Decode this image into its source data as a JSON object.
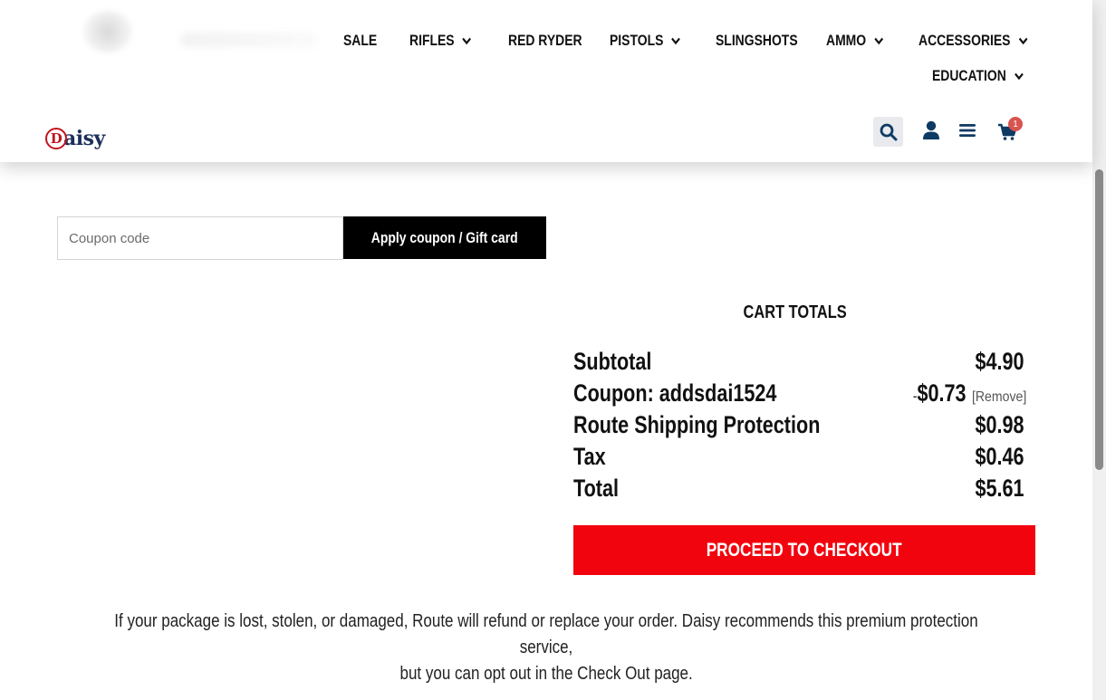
{
  "nav": {
    "items": [
      {
        "label": "SALE",
        "has_dropdown": false
      },
      {
        "label": "RIFLES",
        "has_dropdown": true
      },
      {
        "label": "RED RYDER",
        "has_dropdown": false
      },
      {
        "label": "PISTOLS",
        "has_dropdown": true
      },
      {
        "label": "SLINGSHOTS",
        "has_dropdown": false
      },
      {
        "label": "AMMO",
        "has_dropdown": true
      },
      {
        "label": "ACCESSORIES",
        "has_dropdown": true
      },
      {
        "label": "EDUCATION",
        "has_dropdown": true
      }
    ]
  },
  "logo": {
    "text": "aisy",
    "mark": "D"
  },
  "header_icons": {
    "search": "search-icon",
    "account": "user-icon",
    "menu": "hamburger-icon",
    "cart": "cart-icon",
    "cart_count": "1"
  },
  "coupon": {
    "placeholder": "Coupon code",
    "value": "",
    "apply_label": "Apply coupon / Gift card"
  },
  "cart_totals": {
    "title": "CART TOTALS",
    "subtotal": {
      "label": "Subtotal",
      "value": "$4.90"
    },
    "coupon": {
      "label": "Coupon: addsdai1524",
      "minus": "-",
      "value": "$0.73",
      "remove_label": "[Remove]"
    },
    "route": {
      "label": "Route Shipping Protection",
      "value": "$0.98"
    },
    "tax": {
      "label": "Tax",
      "value": "$0.46"
    },
    "total": {
      "label": "Total",
      "value": "$5.61"
    },
    "checkout_label": "PROCEED TO CHECKOUT"
  },
  "notice": {
    "line1": "If your package is lost, stolen, or damaged, Route will refund or replace your order. Daisy recommends this premium protection service,",
    "line2": "but you can opt out in the Check Out page."
  },
  "colors": {
    "checkout": "#f2040e",
    "apply": "#000000",
    "badge": "#d9534f",
    "brand_navy": "#1b2f5a",
    "icon_navy": "#0f3a63"
  }
}
